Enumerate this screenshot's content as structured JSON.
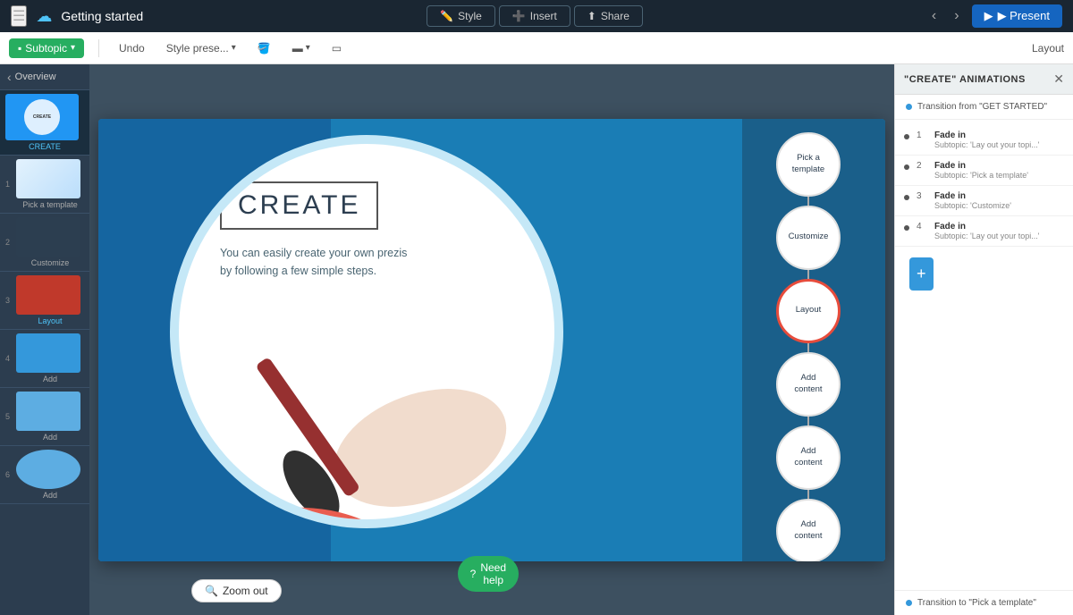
{
  "topbar": {
    "title": "Getting started",
    "style_label": "Style",
    "insert_label": "Insert",
    "share_label": "Share",
    "present_label": "▶ Present"
  },
  "toolbar": {
    "subtopic_label": "Subtopic",
    "undo_label": "Undo",
    "style_preset_label": "Style prese...",
    "layout_label": "Layout"
  },
  "sidebar": {
    "header": "Overview",
    "slides": [
      {
        "num": "",
        "label": "CREATE",
        "active": true,
        "thumb_type": "create"
      },
      {
        "num": "1",
        "label": "Pick a template",
        "active": false,
        "thumb_type": "pick"
      },
      {
        "num": "2",
        "label": "Customize",
        "active": false,
        "thumb_type": "customize"
      },
      {
        "num": "3",
        "label": "Layout",
        "active": false,
        "thumb_type": "layout"
      },
      {
        "num": "4",
        "label": "Add",
        "active": false,
        "thumb_type": "add1"
      },
      {
        "num": "5",
        "label": "Add",
        "active": false,
        "thumb_type": "add2"
      },
      {
        "num": "6",
        "label": "Add",
        "active": false,
        "thumb_type": "add3"
      }
    ]
  },
  "slide": {
    "title": "CREATE",
    "description": "You can easily create your own prezis by following a few simple steps.",
    "circles": [
      {
        "label": "Pick a\ntemplate",
        "active": false
      },
      {
        "label": "Customize",
        "active": false
      },
      {
        "label": "Layout",
        "active": true
      },
      {
        "label": "Add\ncontent",
        "active": false
      },
      {
        "label": "Add\ncontent",
        "active": false
      },
      {
        "label": "Add\ncontent",
        "active": false
      }
    ]
  },
  "right_panel": {
    "title": "\"CREATE\" ANIMATIONS",
    "transition_from": "Transition from \"GET STARTED\"",
    "animations": [
      {
        "num": "1",
        "type": "Fade in",
        "subtitle": "Subtopic: 'Lay out your topi...'"
      },
      {
        "num": "2",
        "type": "Fade in",
        "subtitle": "Subtopic: 'Pick a template'"
      },
      {
        "num": "3",
        "type": "Fade in",
        "subtitle": "Subtopic: 'Customize'"
      },
      {
        "num": "4",
        "type": "Fade in",
        "subtitle": "Subtopic: 'Lay out your topi...'"
      }
    ],
    "transition_to": "Transition to \"Pick a template\"",
    "add_label": "+"
  },
  "zoom": {
    "zoom_out_label": "Zoom out"
  },
  "help": {
    "label": "Need help"
  }
}
